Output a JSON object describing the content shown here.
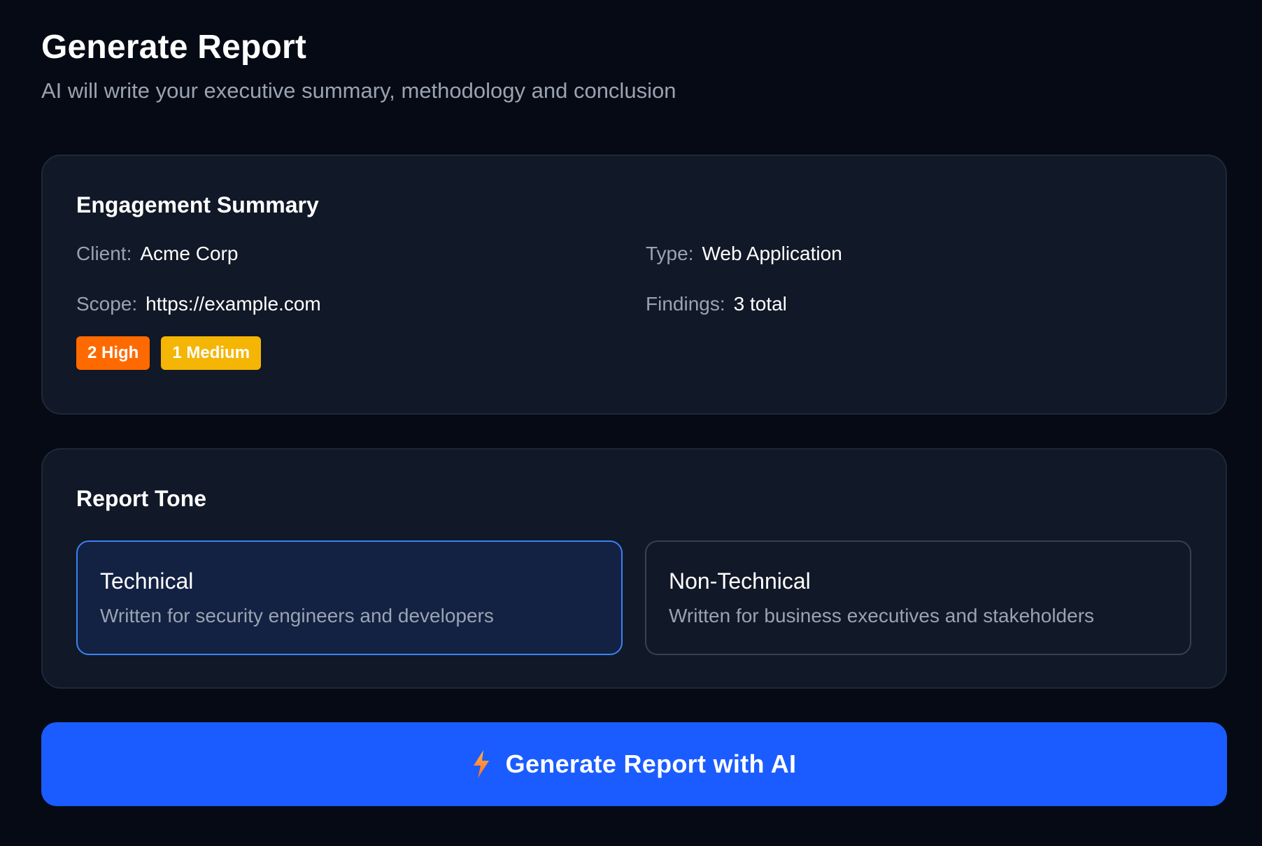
{
  "header": {
    "title": "Generate Report",
    "subtitle": "AI will write your executive summary, methodology and conclusion"
  },
  "summary": {
    "title": "Engagement Summary",
    "client_label": "Client:",
    "client_value": "Acme Corp",
    "type_label": "Type:",
    "type_value": "Web Application",
    "scope_label": "Scope:",
    "scope_value": "https://example.com",
    "findings_label": "Findings:",
    "findings_value": "3 total",
    "badges": [
      {
        "label": "2 High",
        "color": "#ff6a00"
      },
      {
        "label": "1 Medium",
        "color": "#f5b505"
      }
    ]
  },
  "tone": {
    "title": "Report Tone",
    "selected": "Technical",
    "options": [
      {
        "name": "Technical",
        "description": "Written for security engineers and developers"
      },
      {
        "name": "Non-Technical",
        "description": "Written for business executives and stakeholders"
      }
    ]
  },
  "action": {
    "label": "Generate Report with AI",
    "icon": "lightning-bolt-icon",
    "color": "#1a5cff"
  }
}
